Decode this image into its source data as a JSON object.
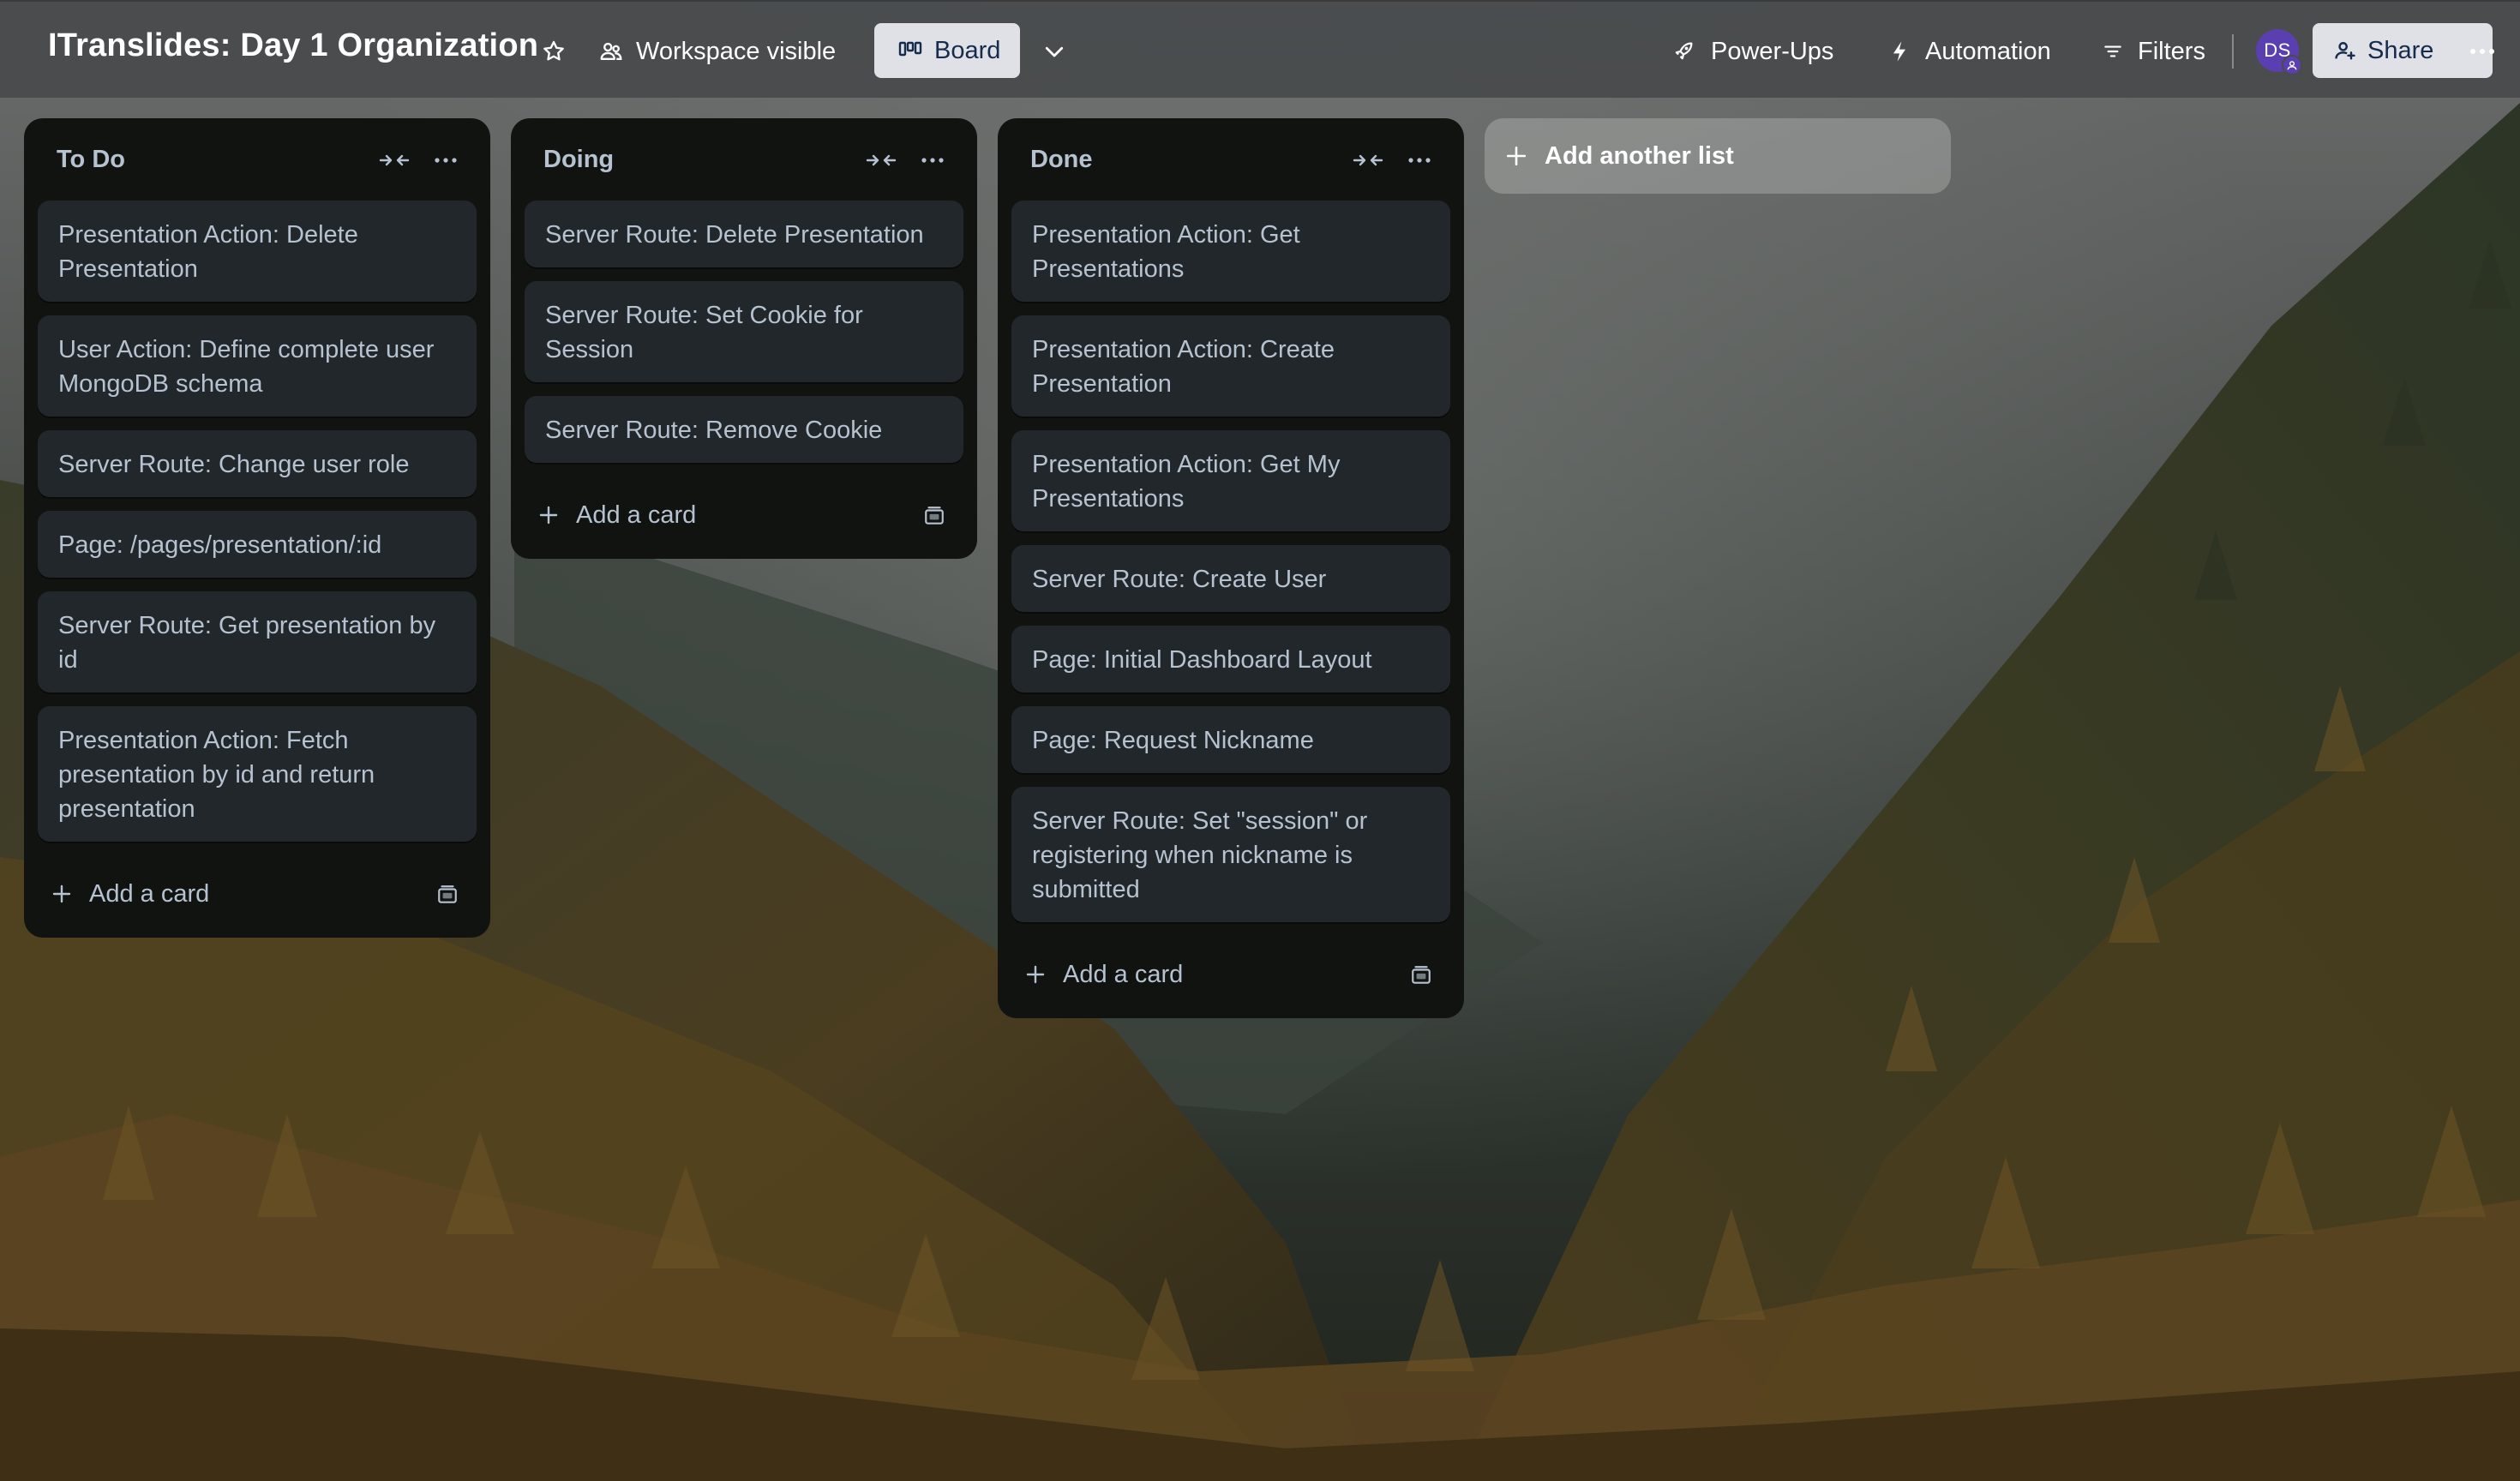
{
  "header": {
    "board_title": "ITranslides: Day 1 Organization",
    "visibility_label": "Workspace visible",
    "view_label": "Board",
    "powerups_label": "Power-Ups",
    "automation_label": "Automation",
    "filters_label": "Filters",
    "avatar_initials": "DS",
    "share_label": "Share"
  },
  "lists": [
    {
      "title": "To Do",
      "cards": [
        "Presentation Action: Delete Presentation",
        "User Action: Define complete user MongoDB schema",
        "Server Route: Change user role",
        "Page: /pages/presentation/:id",
        "Server Route: Get presentation by id",
        "Presentation Action: Fetch presentation by id and return presentation"
      ],
      "add_card_label": "Add a card"
    },
    {
      "title": "Doing",
      "cards": [
        "Server Route: Delete Presentation",
        "Server Route: Set Cookie for Session",
        "Server Route: Remove Cookie"
      ],
      "add_card_label": "Add a card"
    },
    {
      "title": "Done",
      "cards": [
        "Presentation Action: Get Presentations",
        "Presentation Action: Create Presentation",
        "Presentation Action: Get My Presentations",
        "Server Route: Create User",
        "Page: Initial Dashboard Layout",
        "Page: Request Nickname",
        "Server Route: Set \"session\" or registering when nickname is submitted"
      ],
      "add_card_label": "Add a card"
    }
  ],
  "add_list_label": "Add another list",
  "icons": {
    "star": "star-icon",
    "workspace": "people-icon",
    "board": "board-icon",
    "chevron": "chevron-down-icon",
    "powerups": "rocket-icon",
    "automation": "lightning-icon",
    "filters": "filter-icon",
    "share": "add-person-icon",
    "more": "ellipsis-icon",
    "collapse": "collapse-icon",
    "list_menu": "ellipsis-icon",
    "add": "plus-icon",
    "template": "template-icon"
  },
  "colors": {
    "header_bg": "#484a4c",
    "list_bg": "#111311",
    "card_bg": "#22272b",
    "card_text": "#b6c2cf",
    "button_light_bg": "#dfe1e6",
    "avatar_bg": "#5a3fb0"
  }
}
